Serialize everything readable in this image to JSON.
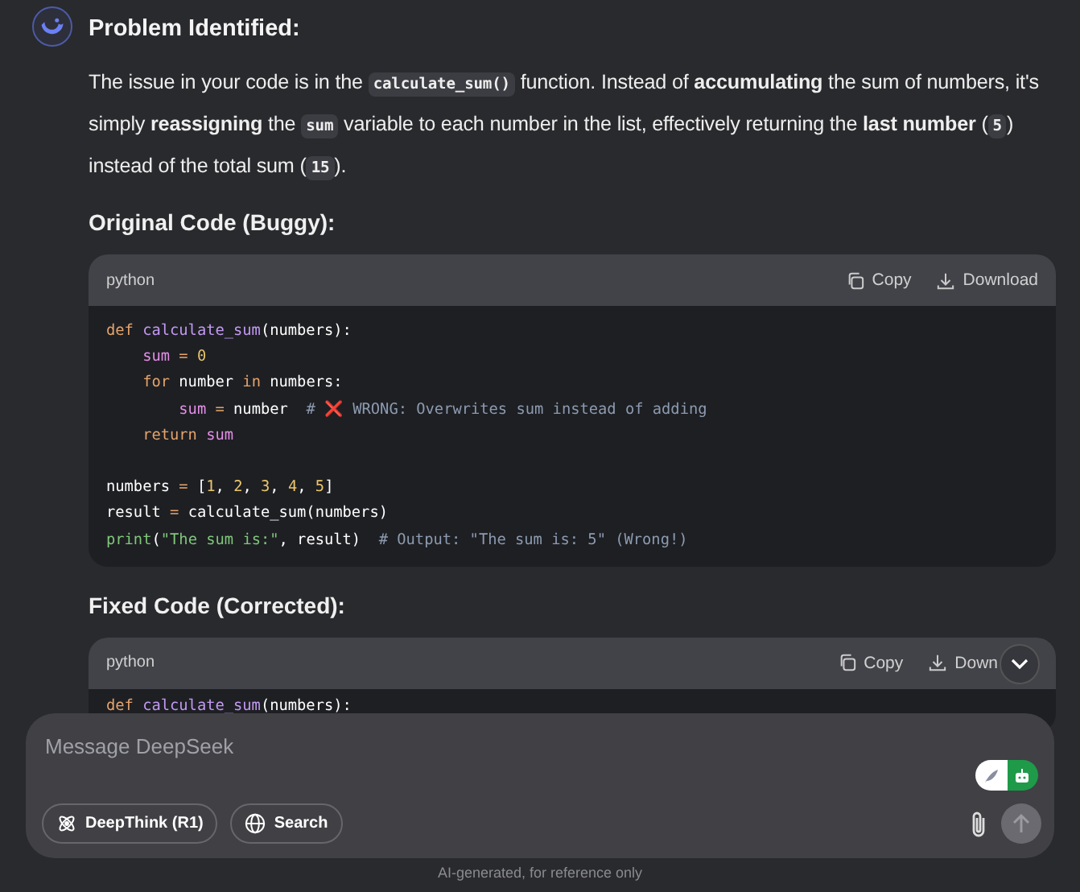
{
  "heading": "Problem Identified:",
  "paragraph": [
    {
      "kind": "text",
      "t": "The issue in your code is in the "
    },
    {
      "kind": "code",
      "t": "calculate_sum()"
    },
    {
      "kind": "text",
      "t": " function. Instead of "
    },
    {
      "kind": "bold",
      "t": "accumulating"
    },
    {
      "kind": "text",
      "t": " the sum of numbers, it's simply "
    },
    {
      "kind": "bold",
      "t": "reassigning"
    },
    {
      "kind": "text",
      "t": " the "
    },
    {
      "kind": "code",
      "t": "sum"
    },
    {
      "kind": "text",
      "t": " variable to each number in the list, effectively returning the "
    },
    {
      "kind": "bold",
      "t": "last number"
    },
    {
      "kind": "text",
      "t": " ("
    },
    {
      "kind": "code",
      "t": "5"
    },
    {
      "kind": "text",
      "t": ") instead of the total sum ("
    },
    {
      "kind": "code",
      "t": "15"
    },
    {
      "kind": "text",
      "t": ")."
    }
  ],
  "sections": [
    {
      "title": "Original Code (Buggy):",
      "language": "python",
      "copy": "Copy",
      "download": "Download",
      "lines": [
        {
          "blank_before": false,
          "tokens": [
            {
              "kind": "kw",
              "t": "def "
            },
            {
              "kind": "fn",
              "t": "calculate_sum"
            },
            {
              "kind": "plain",
              "t": "(numbers):"
            }
          ]
        },
        {
          "blank_before": false,
          "tokens": [
            {
              "kind": "var",
              "t": "    sum"
            },
            {
              "kind": "op",
              "t": " = "
            },
            {
              "kind": "num",
              "t": "0"
            }
          ]
        },
        {
          "blank_before": false,
          "tokens": [
            {
              "kind": "kw",
              "t": "    for"
            },
            {
              "kind": "plain",
              "t": " number "
            },
            {
              "kind": "kw",
              "t": "in"
            },
            {
              "kind": "plain",
              "t": " numbers:"
            }
          ]
        },
        {
          "blank_before": false,
          "tokens": [
            {
              "kind": "var",
              "t": "        sum"
            },
            {
              "kind": "op",
              "t": " = "
            },
            {
              "kind": "plain",
              "t": "number  "
            },
            {
              "kind": "cmt",
              "t": "# "
            },
            {
              "kind": "mark",
              "t": "❌"
            },
            {
              "kind": "cmt",
              "t": " WRONG: Overwrites sum instead of adding"
            }
          ]
        },
        {
          "blank_before": false,
          "tokens": [
            {
              "kind": "kw",
              "t": "    return"
            },
            {
              "kind": "var",
              "t": " sum"
            }
          ]
        },
        {
          "blank_before": true,
          "tokens": [
            {
              "kind": "plain",
              "t": "numbers "
            },
            {
              "kind": "op",
              "t": "= "
            },
            {
              "kind": "plain",
              "t": "["
            },
            {
              "kind": "num",
              "t": "1"
            },
            {
              "kind": "plain",
              "t": ", "
            },
            {
              "kind": "num",
              "t": "2"
            },
            {
              "kind": "plain",
              "t": ", "
            },
            {
              "kind": "num",
              "t": "3"
            },
            {
              "kind": "plain",
              "t": ", "
            },
            {
              "kind": "num",
              "t": "4"
            },
            {
              "kind": "plain",
              "t": ", "
            },
            {
              "kind": "num",
              "t": "5"
            },
            {
              "kind": "plain",
              "t": "]"
            }
          ]
        },
        {
          "blank_before": false,
          "tokens": [
            {
              "kind": "plain",
              "t": "result "
            },
            {
              "kind": "op",
              "t": "= "
            },
            {
              "kind": "plain",
              "t": "calculate_sum(numbers)"
            }
          ]
        },
        {
          "blank_before": false,
          "tokens": [
            {
              "kind": "str",
              "t": "print"
            },
            {
              "kind": "plain",
              "t": "("
            },
            {
              "kind": "str",
              "t": "\"The sum is:\""
            },
            {
              "kind": "plain",
              "t": ", result)  "
            },
            {
              "kind": "cmt",
              "t": "# Output: \"The sum is: 5\" (Wrong!)"
            }
          ]
        }
      ]
    },
    {
      "title": "Fixed Code (Corrected):",
      "language": "python",
      "copy": "Copy",
      "download": "Down",
      "lines": [
        {
          "blank_before": false,
          "tokens": [
            {
              "kind": "kw",
              "t": "def "
            },
            {
              "kind": "fn",
              "t": "calculate_sum"
            },
            {
              "kind": "plain",
              "t": "(numbers):"
            }
          ]
        }
      ]
    }
  ],
  "composer": {
    "placeholder": "Message DeepSeek",
    "buttons": [
      "DeepThink (R1)",
      "Search"
    ],
    "send_disabled": true
  },
  "footer": "AI-generated, for reference only"
}
